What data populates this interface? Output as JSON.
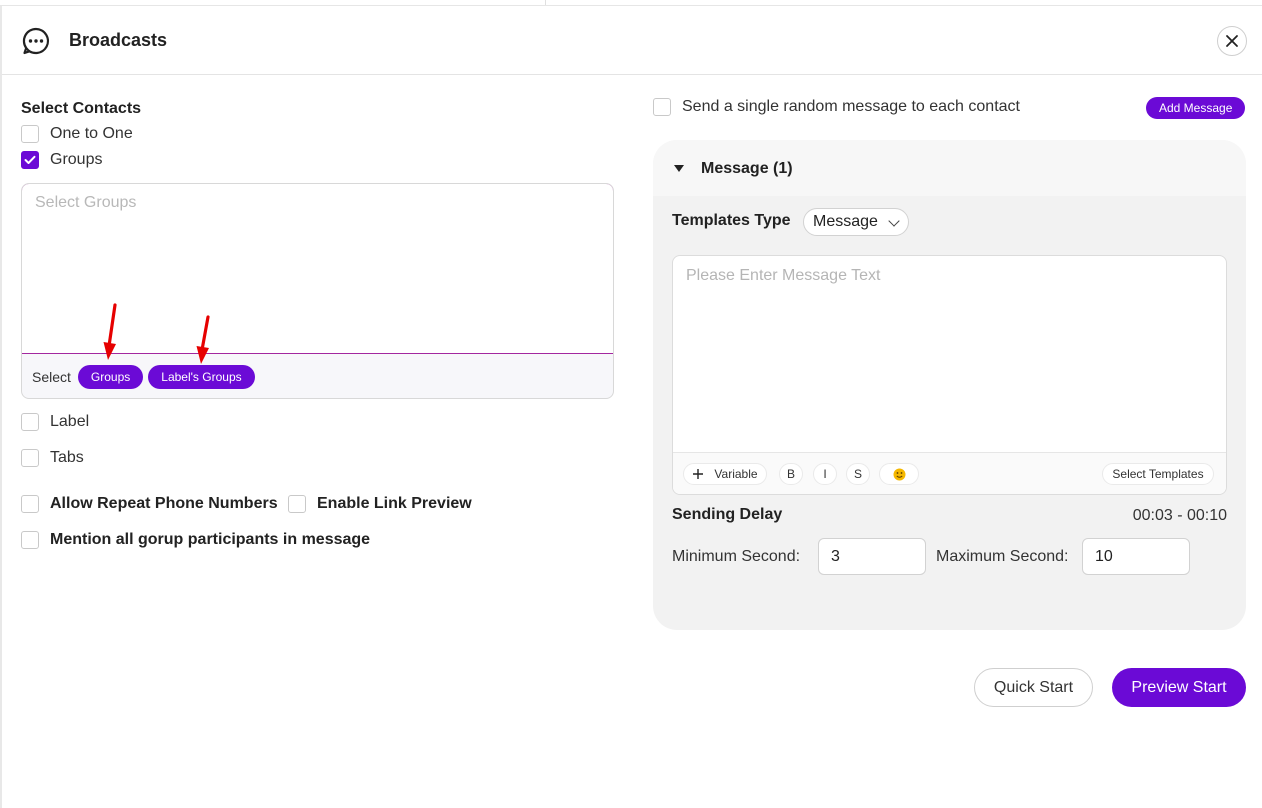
{
  "header": {
    "title": "Broadcasts",
    "icon": "chat-bubble-icon",
    "close_icon": "close-icon"
  },
  "contacts": {
    "section_label": "Select Contacts",
    "one_to_one": {
      "label": "One to One",
      "checked": false
    },
    "groups": {
      "label": "Groups",
      "checked": true
    },
    "groups_picker": {
      "placeholder": "Select Groups",
      "select_label": "Select",
      "buttons": [
        "Groups",
        "Label's Groups"
      ]
    },
    "label": {
      "label": "Label",
      "checked": false
    },
    "tabs": {
      "label": "Tabs",
      "checked": false
    }
  },
  "options": {
    "allow_repeat": {
      "label": "Allow Repeat Phone Numbers",
      "checked": false
    },
    "link_preview": {
      "label": "Enable Link Preview",
      "checked": false
    },
    "mention_all": {
      "label": "Mention all gorup participants in message",
      "checked": false
    }
  },
  "random_message": {
    "label": "Send a single random message to each contact",
    "checked": false
  },
  "add_message_label": "Add Message",
  "message_panel": {
    "title": "Message (1)",
    "templates_type_label": "Templates Type",
    "templates_type_value": "Message",
    "text_placeholder": "Please Enter Message Text",
    "toolbar": {
      "variable": "Variable",
      "bold": "B",
      "italic": "I",
      "strike": "S",
      "emoji": "😀",
      "select_templates": "Select Templates"
    },
    "sending_delay_label": "Sending Delay",
    "sending_delay_range": "00:03 - 00:10",
    "min_label": "Minimum Second",
    "min_value": "3",
    "max_label": "Maximum Second",
    "max_value": "10"
  },
  "footer": {
    "quick_start": "Quick Start",
    "preview_start": "Preview Start"
  },
  "colors": {
    "accent": "#6b0ad6",
    "annotation_arrow": "#e60000",
    "focus_border": "#a3279f"
  }
}
